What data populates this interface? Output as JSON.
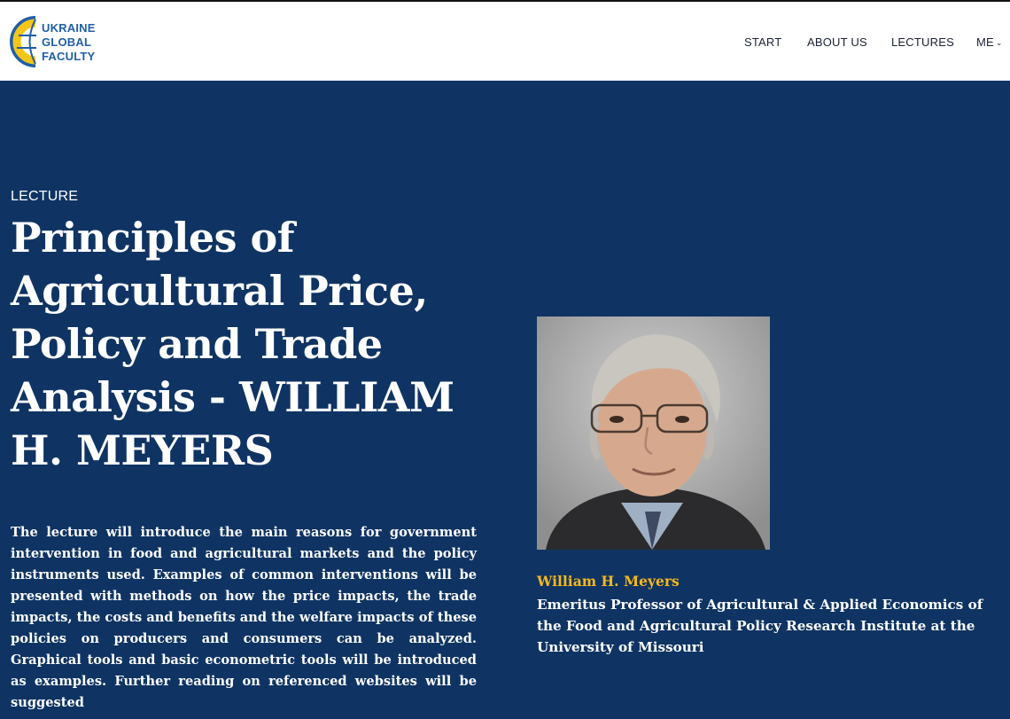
{
  "logo": {
    "lines": [
      "UKRAINE",
      "GLOBAL",
      "FACULTY"
    ],
    "colors": {
      "blue": "#1f5fa8",
      "yellow": "#f5c518"
    }
  },
  "nav": {
    "start": "START",
    "about": "ABOUT US",
    "lectures": "LECTURES",
    "me": "ME",
    "me_icon": "chevron-down-icon"
  },
  "lecture": {
    "eyebrow": "LECTURE",
    "title": "Principles of Agricultural Price, Policy and Trade Analysis - WILLIAM H. MEYERS",
    "description": "The lecture will introduce the main reasons for government intervention in food and agricultural markets and the policy instruments used. Examples of common interventions will be presented with methods on how the price impacts, the trade impacts, the costs and benefits and the welfare impacts of these policies on producers and consumers can be analyzed. Graphical tools and basic econometric tools will be introduced as examples. Further reading on referenced websites will be suggested"
  },
  "speaker": {
    "name": "William H. Meyers",
    "title": "Emeritus Professor of Agricultural & Applied Economics of the Food and Agricultural Policy Research Institute at the University of Missouri"
  },
  "theme": {
    "background": "#0f3463",
    "accent": "#f5b81b",
    "header_bg": "#ffffff"
  }
}
